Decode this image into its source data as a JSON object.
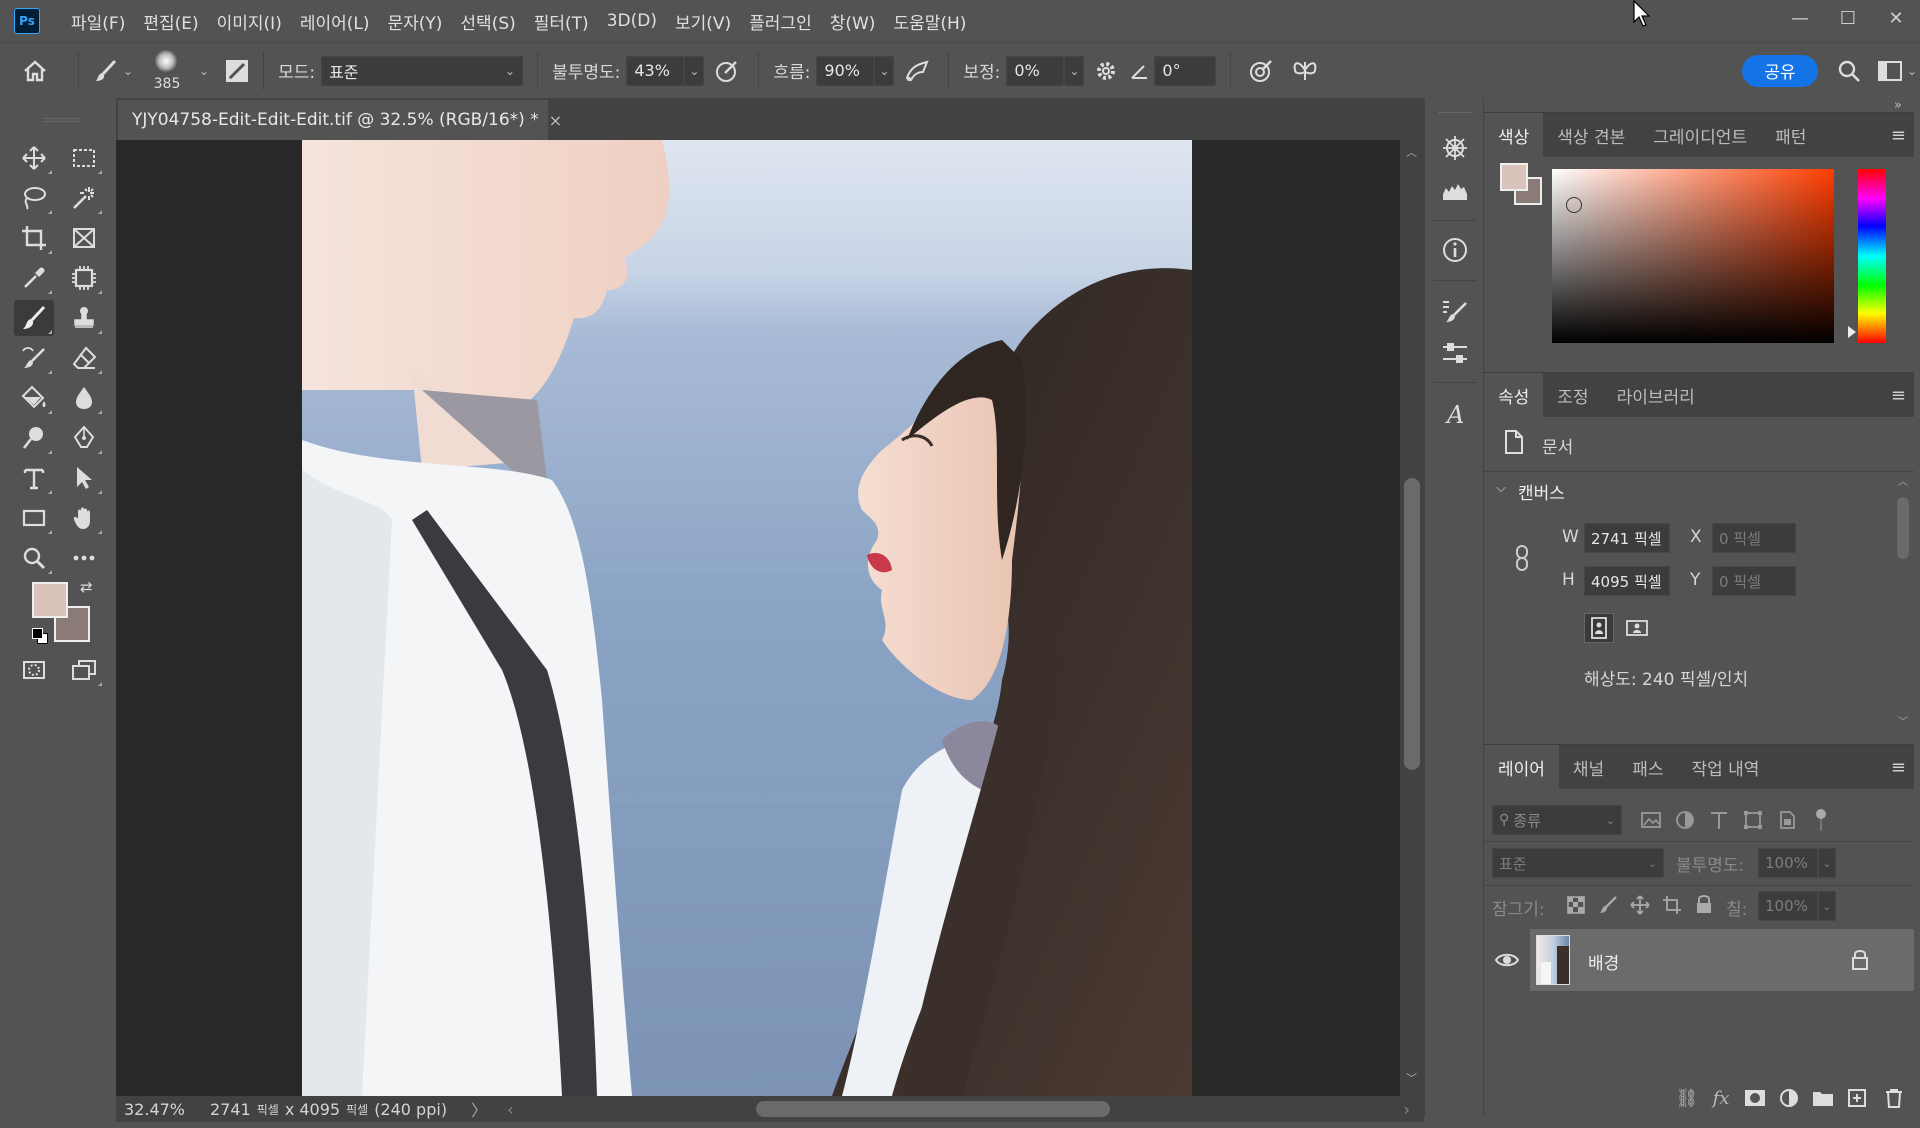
{
  "app": {
    "logo_text": "Ps"
  },
  "menu": [
    "파일(F)",
    "편집(E)",
    "이미지(I)",
    "레이어(L)",
    "문자(Y)",
    "선택(S)",
    "필터(T)",
    "3D(D)",
    "보기(V)",
    "플러그인",
    "창(W)",
    "도움말(H)"
  ],
  "window_controls": {
    "minimize": "—",
    "maximize": "☐",
    "close": "✕"
  },
  "options": {
    "brush_size": "385",
    "mode_label": "모드:",
    "mode_value": "표준",
    "opacity_label": "불투명도:",
    "opacity_value": "43%",
    "flow_label": "흐름:",
    "flow_value": "90%",
    "smoothing_label": "보정:",
    "smoothing_value": "0%",
    "angle_value": "0°",
    "share_label": "공유"
  },
  "document": {
    "tab_title": "YJY04758-Edit-Edit-Edit.tif @ 32.5% (RGB/16*) *",
    "close_glyph": "×",
    "zoom": "32.47%",
    "info_prefix": "2741",
    "info_unit1": "픽셀",
    "info_mid": "x 4095",
    "info_unit2": "픽셀",
    "info_suffix": "(240 ppi)"
  },
  "colors": {
    "foreground": "#d9c3bb",
    "background": "#8b7b76",
    "accent": "#1473e6"
  },
  "color_panel": {
    "tabs": [
      "색상",
      "색상 견본",
      "그레이디언트",
      "패턴"
    ]
  },
  "properties_panel": {
    "tabs": [
      "속성",
      "조정",
      "라이브러리"
    ],
    "doc_label": "문서",
    "section": "캔버스",
    "w_label": "W",
    "w_value": "2741 픽셀",
    "h_label": "H",
    "h_value": "4095 픽셀",
    "x_label": "X",
    "x_placeholder": "0 픽셀",
    "y_label": "Y",
    "y_placeholder": "0 픽셀",
    "resolution": "해상도: 240 픽셀/인치"
  },
  "layers_panel": {
    "tabs": [
      "레이어",
      "채널",
      "패스",
      "작업 내역"
    ],
    "filter_label": "종류",
    "blend_mode": "표준",
    "opacity_label": "불투명도:",
    "opacity_value": "100%",
    "lock_label": "잠그기:",
    "fill_label": "칠:",
    "fill_value": "100%",
    "layers": [
      {
        "name": "배경"
      }
    ]
  }
}
